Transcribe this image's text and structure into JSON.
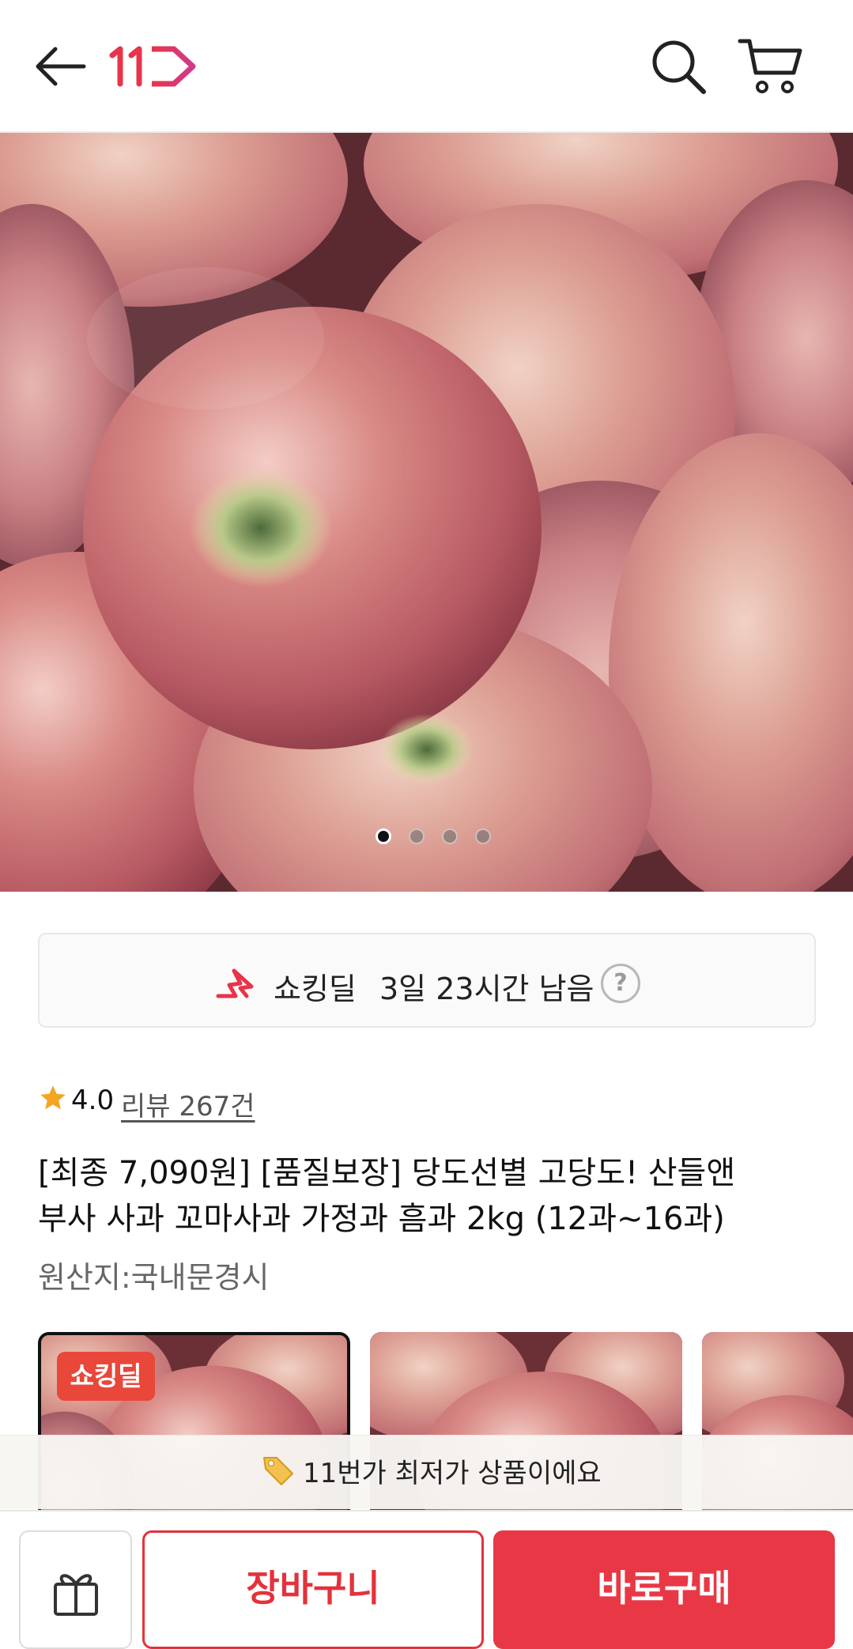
{
  "header": {
    "back_icon": "arrow-left-icon",
    "logo_text": "11",
    "logo_color": "#e8344a",
    "search_icon": "search-icon",
    "cart_icon": "cart-icon"
  },
  "carousel": {
    "total": 4,
    "active_index": 0
  },
  "deal": {
    "label": "쇼킹딜",
    "remaining": "3일 23시간 남음",
    "help": "?",
    "icon": "shocking-deal-icon",
    "accent": "#e8344a"
  },
  "rating": {
    "value": "4.0",
    "review_text": "리뷰 267건",
    "star_color": "#f4a623"
  },
  "product": {
    "title_line1": "[최종 7,090원] [품질보장] 당도선별 고당도! 산들앤",
    "title_line2": "부사 사과 꼬마사과 가정과 흠과 2kg (12과~16과)",
    "origin": "원산지:국내문경시"
  },
  "thumbnails": {
    "badge": "쇼킹딜",
    "count": 3
  },
  "notice": {
    "icon": "price-tag-icon",
    "text": "11번가 최저가 상품이에요"
  },
  "bottom_bar": {
    "gift_icon": "gift-icon",
    "cart_label": "장바구니",
    "buy_label": "바로구매",
    "brand_color": "#e83845"
  }
}
